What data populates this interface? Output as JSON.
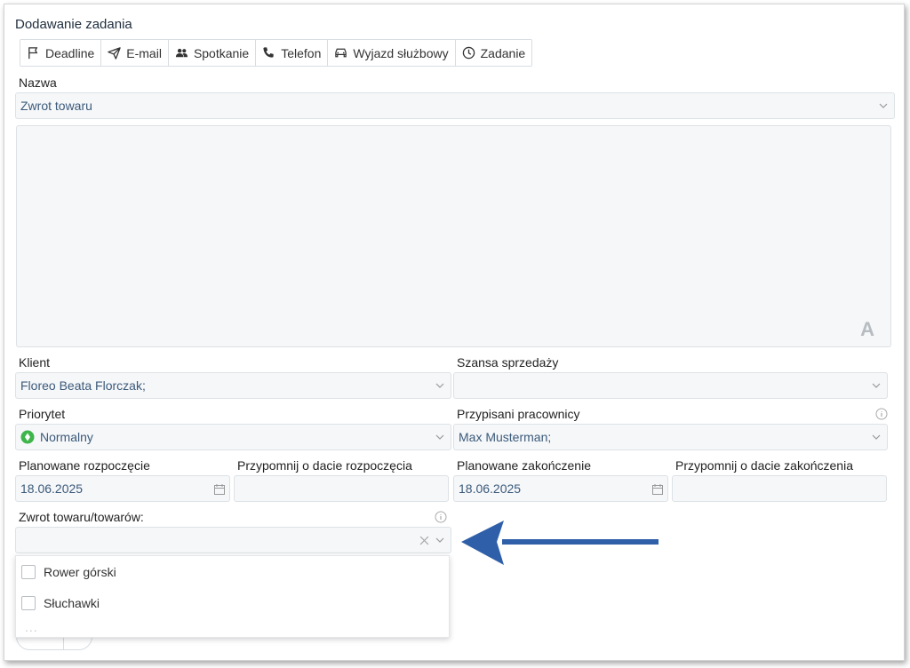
{
  "title": "Dodawanie zadania",
  "tabs": [
    {
      "label": "Deadline",
      "icon": "flag-icon"
    },
    {
      "label": "E-mail",
      "icon": "send-icon"
    },
    {
      "label": "Spotkanie",
      "icon": "users-icon"
    },
    {
      "label": "Telefon",
      "icon": "phone-icon"
    },
    {
      "label": "Wyjazd służbowy",
      "icon": "car-icon"
    },
    {
      "label": "Zadanie",
      "icon": "clock-icon"
    }
  ],
  "form": {
    "name_label": "Nazwa",
    "name_value": "Zwrot towaru",
    "client_label": "Klient",
    "client_value": "Floreo Beata Florczak;",
    "sales_chance_label": "Szansa sprzedaży",
    "sales_chance_value": "",
    "priority_label": "Priorytet",
    "priority_value": "Normalny",
    "assigned_label": "Przypisani pracownicy",
    "assigned_value": "Max Musterman;",
    "planned_start_label": "Planowane rozpoczęcie",
    "planned_start_value": "18.06.2025",
    "remind_start_label": "Przypomnij o dacie rozpoczęcia",
    "planned_end_label": "Planowane zakończenie",
    "planned_end_value": "18.06.2025",
    "remind_end_label": "Przypomnij o dacie zakończenia",
    "returns_label": "Zwrot towaru/towarów:",
    "returns_value": "",
    "editor_font_glyph": "A"
  },
  "dropdown": {
    "options": [
      "Rower górski",
      "Słuchawki"
    ],
    "more": "..."
  },
  "colors": {
    "accent_arrow": "#2e5fa8",
    "priority_green": "#3db54a",
    "field_bg": "#f5f7f9"
  }
}
